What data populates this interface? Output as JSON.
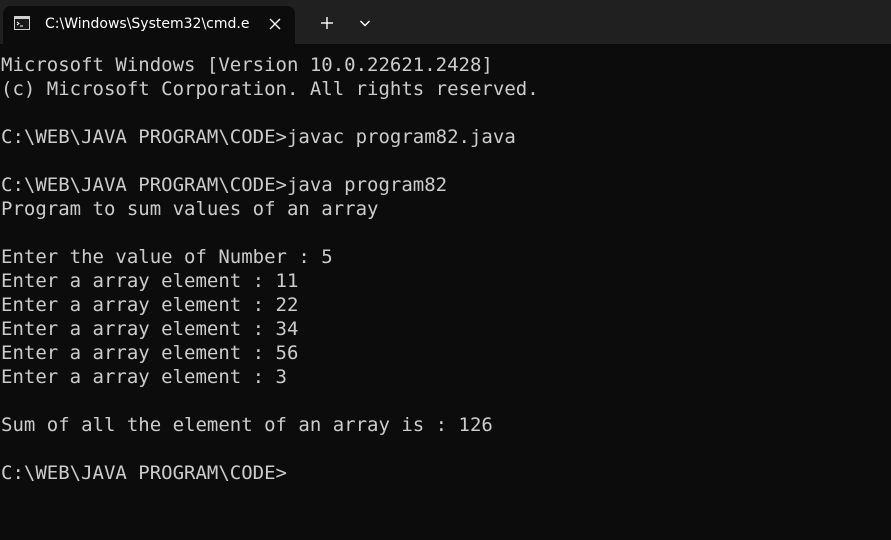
{
  "tab": {
    "title": "C:\\Windows\\System32\\cmd.e"
  },
  "console": {
    "lines": [
      "Microsoft Windows [Version 10.0.22621.2428]",
      "(c) Microsoft Corporation. All rights reserved.",
      "",
      "C:\\WEB\\JAVA PROGRAM\\CODE>javac program82.java",
      "",
      "C:\\WEB\\JAVA PROGRAM\\CODE>java program82",
      "Program to sum values of an array",
      "",
      "Enter the value of Number : 5",
      "Enter a array element : 11",
      "Enter a array element : 22",
      "Enter a array element : 34",
      "Enter a array element : 56",
      "Enter a array element : 3",
      "",
      "Sum of all the element of an array is : 126",
      "",
      "C:\\WEB\\JAVA PROGRAM\\CODE>"
    ]
  },
  "colors": {
    "background": "#0c0c0c",
    "titlebar": "#202020",
    "text": "#cccccc"
  },
  "icons": [
    "cmd-app-icon",
    "close-icon",
    "plus-icon",
    "chevron-down-icon"
  ]
}
